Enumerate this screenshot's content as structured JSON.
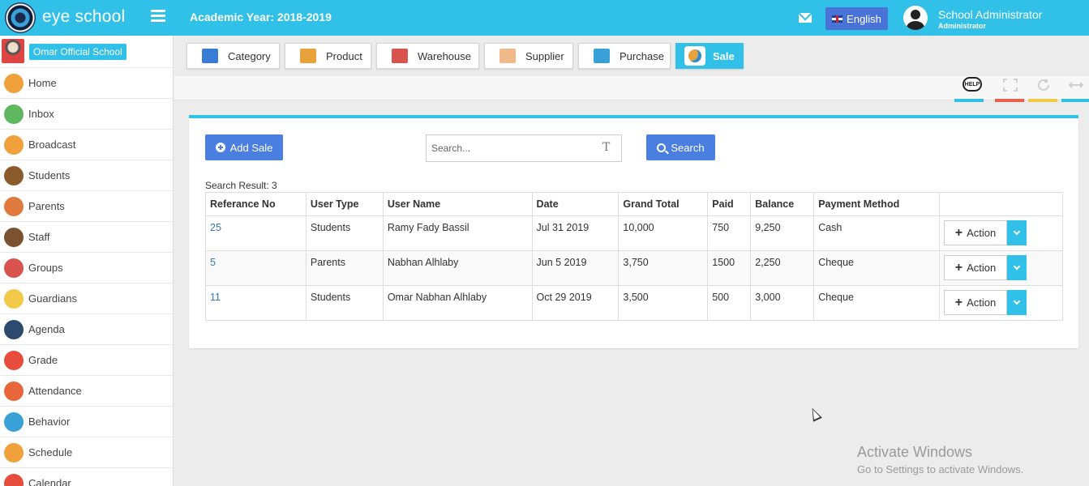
{
  "header": {
    "brand": "eye school",
    "academic_year": "Academic Year: 2018-2019",
    "language": "English",
    "user_name": "School Administrator",
    "user_role": "Administrator"
  },
  "sidebar": {
    "school_name": "Omar Official School",
    "items": [
      {
        "label": "Home",
        "icon": "home-icon",
        "color": "#f0a13b"
      },
      {
        "label": "Inbox",
        "icon": "inbox-icon",
        "color": "#5fb760"
      },
      {
        "label": "Broadcast",
        "icon": "broadcast-icon",
        "color": "#f0a13b"
      },
      {
        "label": "Students",
        "icon": "students-icon",
        "color": "#8b5a2b"
      },
      {
        "label": "Parents",
        "icon": "parents-icon",
        "color": "#e07a3c"
      },
      {
        "label": "Staff",
        "icon": "staff-icon",
        "color": "#7a5230"
      },
      {
        "label": "Groups",
        "icon": "groups-icon",
        "color": "#d9534f"
      },
      {
        "label": "Guardians",
        "icon": "guardians-icon",
        "color": "#f3c94a"
      },
      {
        "label": "Agenda",
        "icon": "agenda-icon",
        "color": "#2c4a6e"
      },
      {
        "label": "Grade",
        "icon": "grade-icon",
        "color": "#e74c3c"
      },
      {
        "label": "Attendance",
        "icon": "attendance-icon",
        "color": "#e8673a"
      },
      {
        "label": "Behavior",
        "icon": "behavior-icon",
        "color": "#3aa0d8"
      },
      {
        "label": "Schedule",
        "icon": "schedule-icon",
        "color": "#f0a13b"
      },
      {
        "label": "Calendar",
        "icon": "calendar-icon",
        "color": "#e74c3c"
      }
    ]
  },
  "tabs": [
    {
      "label": "Category",
      "icon": "category-icon",
      "color": "#3a7bd5"
    },
    {
      "label": "Product",
      "icon": "product-icon",
      "color": "#e8a23c"
    },
    {
      "label": "Warehouse",
      "icon": "warehouse-icon",
      "color": "#d9534f"
    },
    {
      "label": "Supplier",
      "icon": "supplier-icon",
      "color": "#f0b98a"
    },
    {
      "label": "Purchase",
      "icon": "purchase-icon",
      "color": "#3aa0d8"
    },
    {
      "label": "Sale",
      "icon": "sale-icon",
      "color": "#ffffff",
      "active": true
    }
  ],
  "toolbar": {
    "help_label": "HELP",
    "bar_colors": [
      "#31c0e7",
      "#e8604a",
      "#f3c94a",
      "#31c0e7"
    ]
  },
  "content": {
    "add_button": "Add Sale",
    "search_placeholder": "Search...",
    "search_button": "Search",
    "result_count": "Search Result: 3",
    "action_label": "Action"
  },
  "table": {
    "columns": [
      "Referance No",
      "User Type",
      "User Name",
      "Date",
      "Grand Total",
      "Paid",
      "Balance",
      "Payment Method",
      ""
    ],
    "rows": [
      [
        "25",
        "Students",
        "Ramy Fady Bassil",
        "Jul 31 2019",
        "10,000",
        "750",
        "9,250",
        "Cash"
      ],
      [
        "5",
        "Parents",
        "Nabhan Alhlaby",
        "Jun 5 2019",
        "3,750",
        "1500",
        "2,250",
        "Cheque"
      ],
      [
        "11",
        "Students",
        "Omar Nabhan Alhlaby",
        "Oct 29 2019",
        "3,500",
        "500",
        "3,000",
        "Cheque"
      ]
    ]
  },
  "watermark": {
    "title": "Activate Windows",
    "subtitle": "Go to Settings to activate Windows."
  },
  "colors": {
    "accent": "#31c0e7",
    "primary_button": "#4a7ee0"
  }
}
